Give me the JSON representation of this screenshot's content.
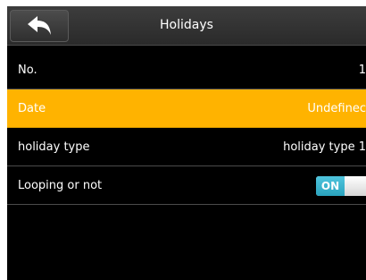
{
  "header": {
    "title": "Holidays",
    "back_icon": "back-arrow-icon"
  },
  "rows": [
    {
      "label": "No.",
      "value": "1"
    },
    {
      "label": "Date",
      "value": "Undefinec",
      "selected": true
    },
    {
      "label": "holiday type",
      "value": "holiday type 1"
    },
    {
      "label": "Looping or not",
      "toggle": "ON"
    }
  ],
  "colors": {
    "selected_row": "#ffb300",
    "toggle_on": "#2aa3be",
    "background": "#000000"
  }
}
